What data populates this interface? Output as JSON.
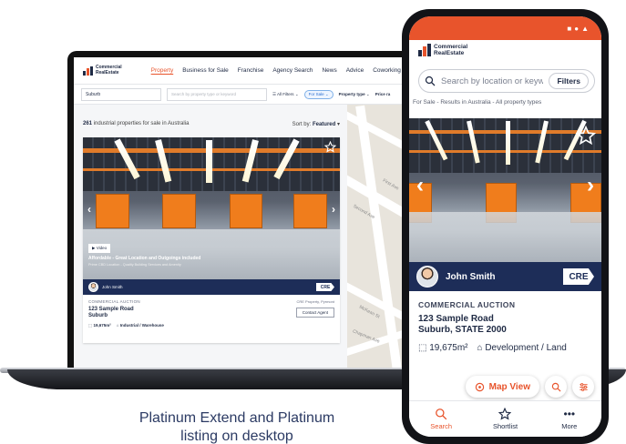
{
  "brand": {
    "line1": "Commercial",
    "line2": "RealEstate",
    "accent": "#e8542c",
    "navy": "#1d2d58"
  },
  "desktop": {
    "nav": [
      "Property",
      "Business for Sale",
      "Franchise",
      "Agency Search",
      "News",
      "Advice",
      "Coworking",
      "In"
    ],
    "search": {
      "suburb": "Suburb",
      "keyword_placeholder": "Search by property type or keyword",
      "all_filters": "All Filters",
      "for_sale": "For Sale",
      "property_type": "Property type",
      "price": "Price ra"
    },
    "results": {
      "count": "261",
      "text": " industrial properties for sale in Australia",
      "sort_label": "Sort by: ",
      "sort_value": "Featured"
    },
    "card": {
      "video": "Video",
      "headline": "Affordable - Great Location and Outgoings included",
      "subline": "Prime CBD Location - Quality Building Services and Amenity",
      "agent": "John Smith",
      "cre": "CRE",
      "type": "COMMERCIAL AUCTION",
      "agency": "CRE Property, Pyrmont",
      "contact": "Contact Agent",
      "address1": "123 Sample Road",
      "address2": "Suburb",
      "area": "19,675m²",
      "category": "Industrial / Warehouse"
    },
    "map_labels": [
      "First Ave",
      "Second Ave",
      "McKean St",
      "Chapman Ave"
    ]
  },
  "phone": {
    "search_placeholder": "Search by location or keyword",
    "filters": "Filters",
    "breadcrumb": "For Sale - Results in Australia - All property types",
    "agent": "John Smith",
    "cre": "CRE",
    "type": "COMMERCIAL AUCTION",
    "address1": "123 Sample Road",
    "address2": "Suburb, STATE 2000",
    "area": "19,675m²",
    "category": "Development / Land",
    "map_view": "Map View",
    "tabs": {
      "search": "Search",
      "shortlist": "Shortlist",
      "more": "More"
    }
  },
  "caption": {
    "line1": "Platinum Extend and Platinum",
    "line2": "listing on desktop"
  }
}
